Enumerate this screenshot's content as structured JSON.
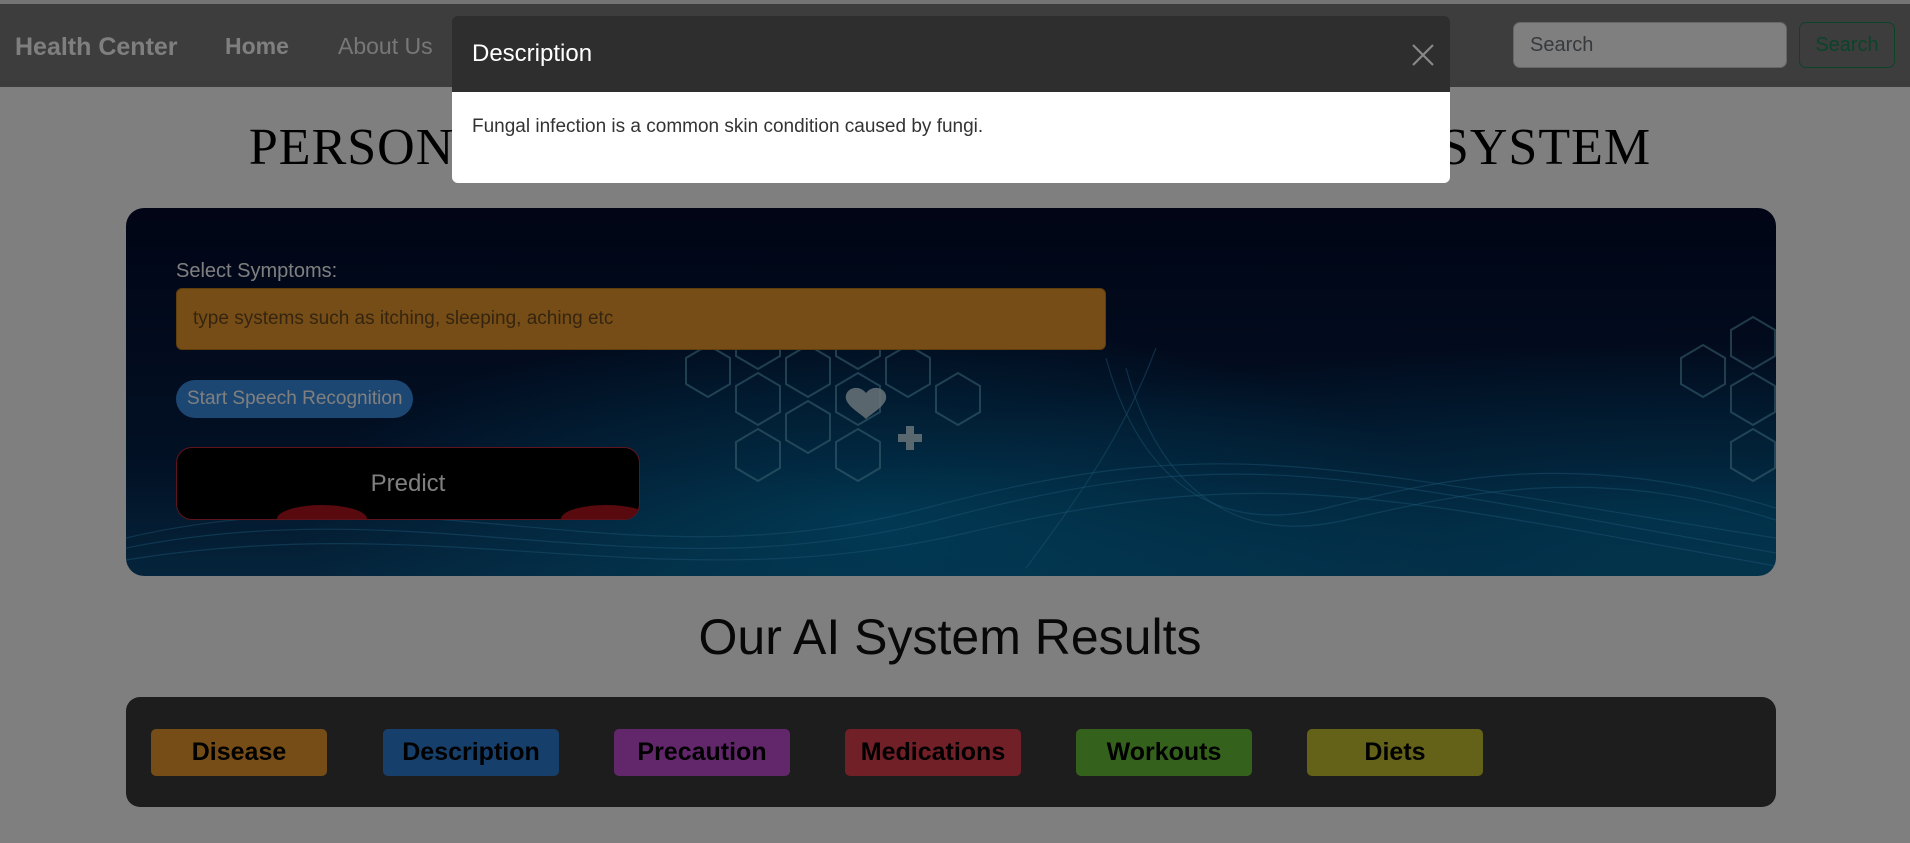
{
  "navbar": {
    "brand": "Health Center",
    "links": [
      "Home",
      "About Us"
    ],
    "search_placeholder": "Search",
    "search_button": "Search"
  },
  "page": {
    "heading": "PERSONALIZED MEDICAL RECOMMENDATION SYSTEM"
  },
  "hero": {
    "symptoms_label": "Select Symptoms:",
    "symptoms_placeholder": "type systems such as itching, sleeping, aching etc",
    "speech_button": "Start Speech Recognition",
    "predict_button": "Predict"
  },
  "results": {
    "heading": "Our AI System Results",
    "buttons": [
      {
        "label": "Disease",
        "color": "#ec9a2c"
      },
      {
        "label": "Description",
        "color": "#2f7fd8"
      },
      {
        "label": "Precaution",
        "color": "#c54fd6"
      },
      {
        "label": "Medications",
        "color": "#e2404e"
      },
      {
        "label": "Workouts",
        "color": "#68c43a"
      },
      {
        "label": "Diets",
        "color": "#c8c432"
      }
    ]
  },
  "modal": {
    "title": "Description",
    "body": "Fungal infection is a common skin condition caused by fungi."
  }
}
